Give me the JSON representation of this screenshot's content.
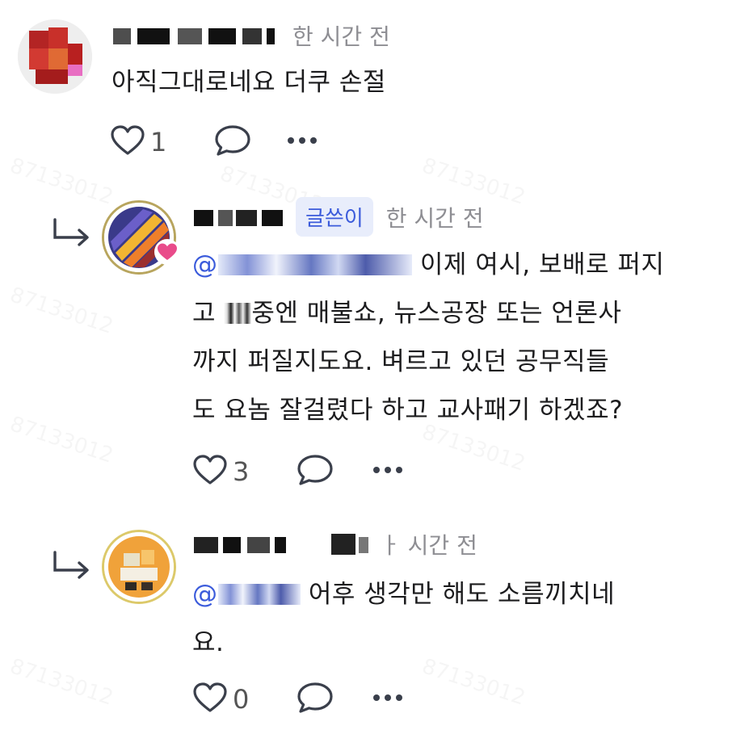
{
  "comments": [
    {
      "author": "",
      "time": "한 시간 전",
      "text": "아직그대로네요 더쿠 손절",
      "likes": "1"
    },
    {
      "author": "",
      "badge": "글쓴이",
      "time": "한 시간 전",
      "mention": "@",
      "text_line1": "이제 여시, 보배로 퍼지",
      "text_line2_a": "고 ",
      "text_line2_b": "중엔 매불쇼, 뉴스공장 또는 언론사",
      "text_line3": "까지 퍼질지도요. 벼르고 있던 공무직들",
      "text_line4": "도 요놈 잘걸렸다 하고 교사패기 하겠죠?",
      "likes": "3"
    },
    {
      "author": "",
      "time": "한 시간 전",
      "time_visible": "ㅏ 시간 전",
      "mention": "@",
      "text_line1": "어후 생각만 해도 소름끼치네",
      "text_line2": "요.",
      "likes": "0"
    }
  ],
  "watermark": "87133012",
  "icons": {
    "like": "heart-outline-icon",
    "reply": "speech-bubble-icon",
    "more": "more-dots-icon",
    "reply_arrow": "reply-arrow-icon"
  },
  "colors": {
    "accent": "#3b5bdb",
    "badge_bg": "#e8edfb",
    "muted": "#8e8e93",
    "heart_badge": "#e94b8a"
  }
}
